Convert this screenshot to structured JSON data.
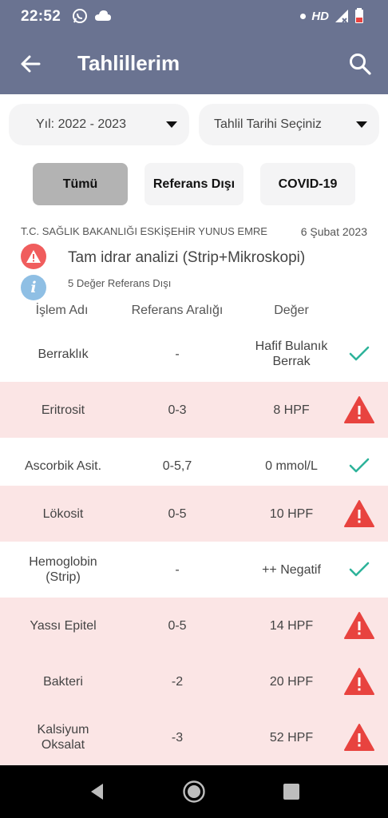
{
  "status_bar": {
    "time": "22:52",
    "network_label": "HD",
    "icons": [
      "whatsapp-icon",
      "cloud-icon",
      "dot-icon",
      "signal-icon",
      "battery-icon"
    ]
  },
  "app_bar": {
    "title": "Tahlillerim",
    "icons": [
      "back-arrow-icon",
      "search-icon"
    ]
  },
  "filters": {
    "year_dropdown": "Yıl: 2022 - 2023",
    "date_dropdown": "Tahlil Tarihi Seçiniz",
    "tabs": [
      {
        "label": "Tümü",
        "active": true
      },
      {
        "label": "Referans Dışı",
        "active": false
      },
      {
        "label": "COVID-19",
        "active": false
      }
    ]
  },
  "result": {
    "hospital": "T.C. SAĞLIK BAKANLIĞI ESKİŞEHİR YUNUS EMRE",
    "date": "6 Şubat 2023",
    "test_name": "Tam idrar analizi (Strip+Mikroskopi)",
    "out_of_range_text": "5 Değer Referans Dışı",
    "info_glyph": "i"
  },
  "table": {
    "headers": [
      "İşlem Adı",
      "Referans Aralığı",
      "Değer"
    ],
    "rows": [
      {
        "name": "Berraklık",
        "range": "-",
        "value": "Hafif Bulanık Berrak",
        "status": "ok"
      },
      {
        "name": "Eritrosit",
        "range": "0-3",
        "value": "8 HPF",
        "status": "warning"
      },
      {
        "name": "Ascorbik Asit.",
        "range": "0-5,7",
        "value": "0 mmol/L",
        "status": "ok"
      },
      {
        "name": "Lökosit",
        "range": "0-5",
        "value": "10 HPF",
        "status": "warning"
      },
      {
        "name": "Hemoglobin (Strip)",
        "range": "-",
        "value": "++ Negatif",
        "status": "ok"
      },
      {
        "name": "Yassı Epitel",
        "range": "0-5",
        "value": "14 HPF",
        "status": "warning"
      },
      {
        "name": "Bakteri",
        "range": "-2",
        "value": "20 HPF",
        "status": "warning"
      },
      {
        "name": "Kalsiyum Oksalat",
        "range": "-3",
        "value": "52 HPF",
        "status": "warning"
      }
    ]
  },
  "colors": {
    "app_bar": "#6a7391",
    "warning_red": "#e8433f",
    "ok_green": "#2eb39a",
    "out_of_range_row": "#fbe5e5",
    "info_blue": "#8fbfe4"
  },
  "nav_bar": {
    "icons": [
      "back-triangle-icon",
      "home-circle-icon",
      "recents-square-icon"
    ]
  }
}
